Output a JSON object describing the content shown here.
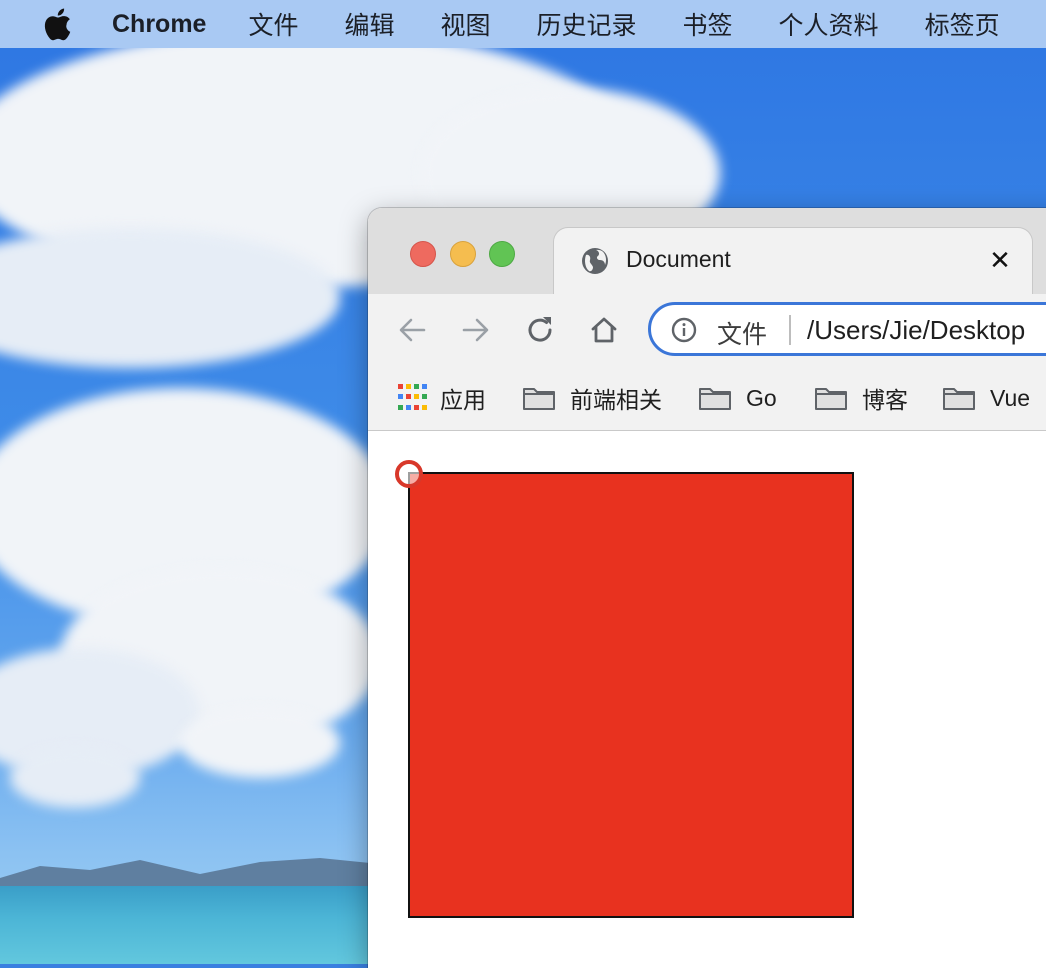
{
  "menubar": {
    "app_name": "Chrome",
    "items": [
      "文件",
      "编辑",
      "视图",
      "历史记录",
      "书签",
      "个人资料",
      "标签页"
    ]
  },
  "browser": {
    "tab": {
      "title": "Document",
      "icon": "globe-icon",
      "close_label": "✕"
    },
    "toolbar": {
      "back_icon": "arrow-left-icon",
      "forward_icon": "arrow-right-icon",
      "reload_icon": "reload-icon",
      "home_icon": "home-icon"
    },
    "omnibox": {
      "scheme_label": "文件",
      "url": "/Users/Jie/Desktop"
    },
    "bookmarks": [
      {
        "label": "应用",
        "icon": "apps-grid-icon"
      },
      {
        "label": "前端相关",
        "icon": "folder-icon"
      },
      {
        "label": "Go",
        "icon": "folder-icon"
      },
      {
        "label": "博客",
        "icon": "folder-icon"
      },
      {
        "label": "Vue",
        "icon": "folder-icon"
      }
    ]
  },
  "page_content": {
    "box_color": "#e8321f",
    "box_border_color": "#111111",
    "cursor_indicator_color": "#d8382a"
  },
  "colors": {
    "menubar_bg": "#a9c9f3",
    "omnibox_border": "#3b76d8",
    "traffic_red": "#ee6a5f",
    "traffic_yellow": "#f5bd4f",
    "traffic_green": "#61c454"
  }
}
